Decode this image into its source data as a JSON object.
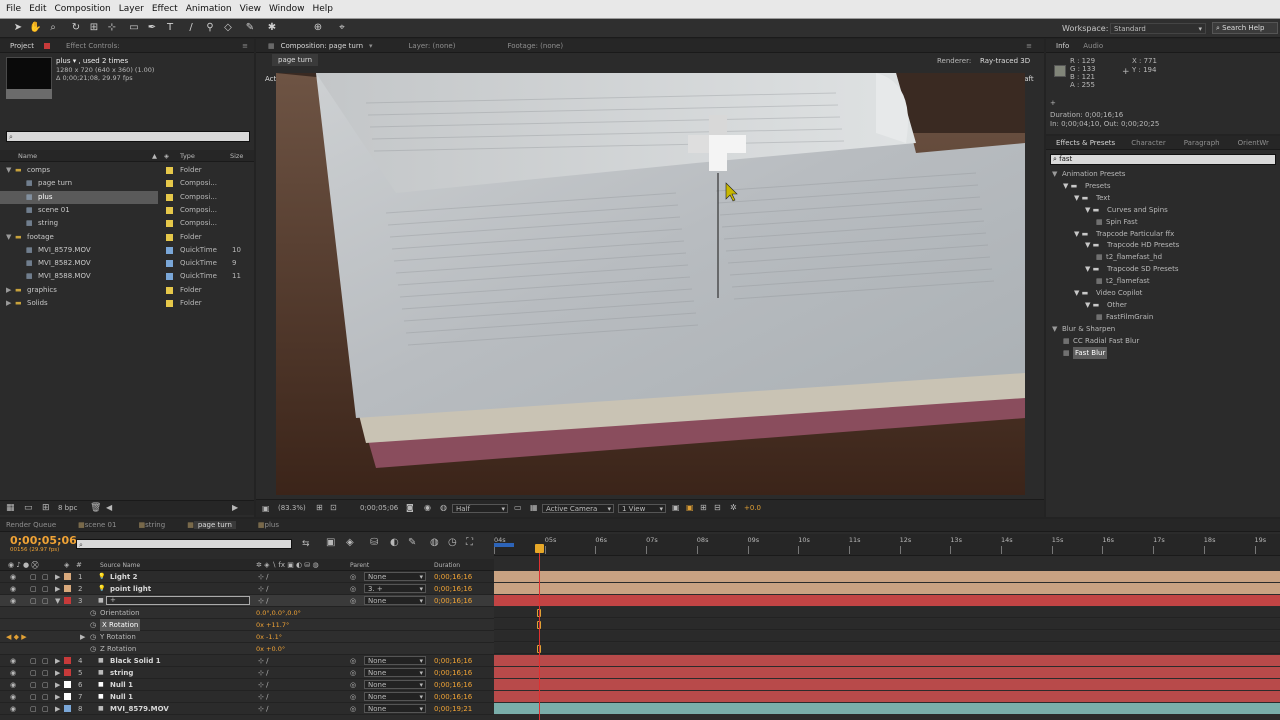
{
  "menu": [
    "File",
    "Edit",
    "Composition",
    "Layer",
    "Effect",
    "Animation",
    "View",
    "Window",
    "Help"
  ],
  "workspace": {
    "label": "Workspace:",
    "value": "Standard",
    "search": "Search Help"
  },
  "project": {
    "tabs": [
      "Project",
      "Effect Controls: "
    ],
    "item_name": "plus ▾ , used 2 times",
    "item_dims": "1280 x 720  (640 x 360) (1.00)",
    "item_dur": "Δ 0;00;21;08, 29.97 fps",
    "col_name": "Name",
    "col_type": "Type",
    "col_size": "Size",
    "items": [
      {
        "name": "comps",
        "type": "Folder",
        "color": "#e6c84a",
        "indent": 0,
        "exp": "▼"
      },
      {
        "name": "page turn",
        "type": "Composi...",
        "color": "#e6c84a",
        "indent": 1,
        "exp": ""
      },
      {
        "name": "plus",
        "type": "Composi...",
        "color": "#e6c84a",
        "indent": 1,
        "exp": "",
        "sel": true
      },
      {
        "name": "scene 01",
        "type": "Composi...",
        "color": "#e6c84a",
        "indent": 1,
        "exp": ""
      },
      {
        "name": "string",
        "type": "Composi...",
        "color": "#e6c84a",
        "indent": 1,
        "exp": ""
      },
      {
        "name": "footage",
        "type": "Folder",
        "color": "#e6c84a",
        "indent": 0,
        "exp": "▼"
      },
      {
        "name": "MVI_8579.MOV",
        "type": "QuickTime",
        "color": "#7aa7d8",
        "indent": 1,
        "exp": "",
        "size": "10"
      },
      {
        "name": "MVI_8582.MOV",
        "type": "QuickTime",
        "color": "#7aa7d8",
        "indent": 1,
        "exp": "",
        "size": "9"
      },
      {
        "name": "MVI_8588.MOV",
        "type": "QuickTime",
        "color": "#7aa7d8",
        "indent": 1,
        "exp": "",
        "size": "11"
      },
      {
        "name": "graphics",
        "type": "Folder",
        "color": "#e6c84a",
        "indent": 0,
        "exp": "▶"
      },
      {
        "name": "Solids",
        "type": "Folder",
        "color": "#e6c84a",
        "indent": 0,
        "exp": "▶"
      }
    ],
    "bpc": "8 bpc"
  },
  "viewer": {
    "tab": "Composition: page turn",
    "layer_tab": "Layer: (none)",
    "footage_tab": "Footage: (none)",
    "subtab": "page turn",
    "renderer_label": "Renderer:",
    "renderer": "Ray-traced 3D",
    "camera": "Active Camera",
    "draft": "Draft",
    "zoom": "(83.3%)",
    "time": "0;00;05;06",
    "res": "Half",
    "view_cam": "Active Camera",
    "views": "1 View",
    "exposure": "+0.0"
  },
  "info": {
    "tabs": [
      "Info",
      "Audio"
    ],
    "r": "R : 129",
    "g": "G : 133",
    "b": "B : 121",
    "a": "A : 255",
    "x": "X : 771",
    "y": "Y : 194",
    "duration": "Duration: 0;00;16;16",
    "inout": "In: 0;00;04;10, Out: 0;00;20;25"
  },
  "fx": {
    "tabs": [
      "Effects & Presets",
      "Character",
      "Paragraph",
      "OrientWr"
    ],
    "query": "fast",
    "tree": [
      {
        "t": "Animation Presets",
        "d": 0,
        "k": "tri"
      },
      {
        "t": "Presets",
        "d": 1,
        "k": "folder"
      },
      {
        "t": "Text",
        "d": 2,
        "k": "folder"
      },
      {
        "t": "Curves and Spins",
        "d": 3,
        "k": "folder"
      },
      {
        "t": "Spin Fast",
        "d": 4,
        "k": "preset"
      },
      {
        "t": "Trapcode Particular ffx",
        "d": 2,
        "k": "folder"
      },
      {
        "t": "Trapcode HD Presets",
        "d": 3,
        "k": "folder"
      },
      {
        "t": "t2_flamefast_hd",
        "d": 4,
        "k": "preset"
      },
      {
        "t": "Trapcode SD Presets",
        "d": 3,
        "k": "folder"
      },
      {
        "t": "t2_flamefast",
        "d": 4,
        "k": "preset"
      },
      {
        "t": "Video Copilot",
        "d": 2,
        "k": "folder"
      },
      {
        "t": "Other",
        "d": 3,
        "k": "folder"
      },
      {
        "t": "FastFilmGrain",
        "d": 4,
        "k": "preset"
      },
      {
        "t": "Blur & Sharpen",
        "d": 0,
        "k": "tri"
      },
      {
        "t": "CC Radial Fast Blur",
        "d": 1,
        "k": "effect"
      },
      {
        "t": "Fast Blur",
        "d": 1,
        "k": "effect",
        "sel": true
      }
    ]
  },
  "timeline": {
    "tabs": [
      "Render Queue",
      "scene 01",
      "string",
      "page turn",
      "plus"
    ],
    "timecode": "0;00;05;06",
    "fps": "00156 (29.97 fps)",
    "col_source": "Source Name",
    "col_parent": "Parent",
    "col_duration": "Duration",
    "ruler": [
      "04s",
      "05s",
      "06s",
      "07s",
      "08s",
      "09s",
      "10s",
      "11s",
      "12s",
      "13s",
      "14s",
      "15s",
      "16s",
      "17s",
      "18s",
      "19s"
    ],
    "layers": [
      {
        "n": "1",
        "name": "Light 2",
        "parent": "None",
        "dur": "0;00;16;16",
        "color": "#d9a97c",
        "bar": "#c9a282"
      },
      {
        "n": "2",
        "name": "point light",
        "parent": "3. +",
        "dur": "0;00;16;16",
        "color": "#d9a97c",
        "bar": "#c9a282"
      },
      {
        "n": "3",
        "name": "+",
        "parent": "None",
        "dur": "0;00;16;16",
        "color": "#c73a3a",
        "bar": "#c24444",
        "edit": true
      },
      {
        "n": "4",
        "name": "Black Solid 1",
        "parent": "None",
        "dur": "0;00;16;16",
        "color": "#c73a3a",
        "bar": "#b84a4a"
      },
      {
        "n": "5",
        "name": "string",
        "parent": "None",
        "dur": "0;00;16;16",
        "color": "#c73a3a",
        "bar": "#b84a4a"
      },
      {
        "n": "6",
        "name": "Null 1",
        "parent": "None",
        "dur": "0;00;16;16",
        "color": "#ffffff",
        "bar": "#b84a4a"
      },
      {
        "n": "7",
        "name": "Null 1",
        "parent": "None",
        "dur": "0;00;16;16",
        "color": "#ffffff",
        "bar": "#b84a4a"
      },
      {
        "n": "8",
        "name": "MVI_8579.MOV",
        "parent": "None",
        "dur": "0;00;19;21",
        "color": "#7aa7d8",
        "bar": "#7aaeaa"
      }
    ],
    "props": [
      {
        "name": "Orientation",
        "val": "0.0°,0.0°,0.0°"
      },
      {
        "name": "X Rotation",
        "val": "0x +11.7°",
        "sel": true
      },
      {
        "name": "Y Rotation",
        "val": "0x -1.1°"
      },
      {
        "name": "Z Rotation",
        "val": "0x +0.0°"
      }
    ]
  }
}
